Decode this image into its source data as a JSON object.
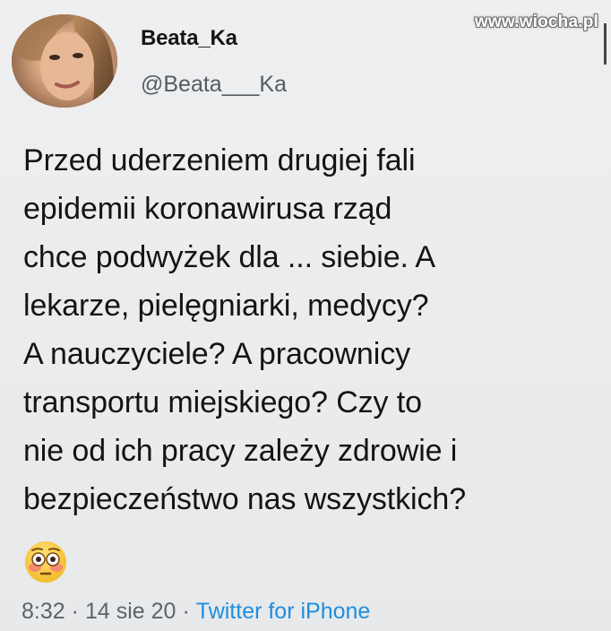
{
  "watermark": "www.wiocha.pl",
  "tweet": {
    "author": {
      "display_name": "Beata_Ka",
      "handle": "@Beata___Ka"
    },
    "text": "Przed uderzeniem drugiej fali\nepidemii koronawirusa rząd\nchce podwyżek dla ... siebie. A\nlekarze, pielęgniarki, medycy?\nA nauczyciele? A pracownicy\ntransportu miejskiego? Czy to\nnie od ich pracy zależy zdrowie i\nbezpieczeństwo nas wszystkich?",
    "emoji_icon": "flushed-face-emoji",
    "time": "8:32",
    "date": "14 sie 20",
    "separator": "·",
    "source": "Twitter for iPhone"
  },
  "colors": {
    "background": "#ebecee",
    "source_link": "#1d8fe0",
    "meta_text": "#5d646b"
  }
}
